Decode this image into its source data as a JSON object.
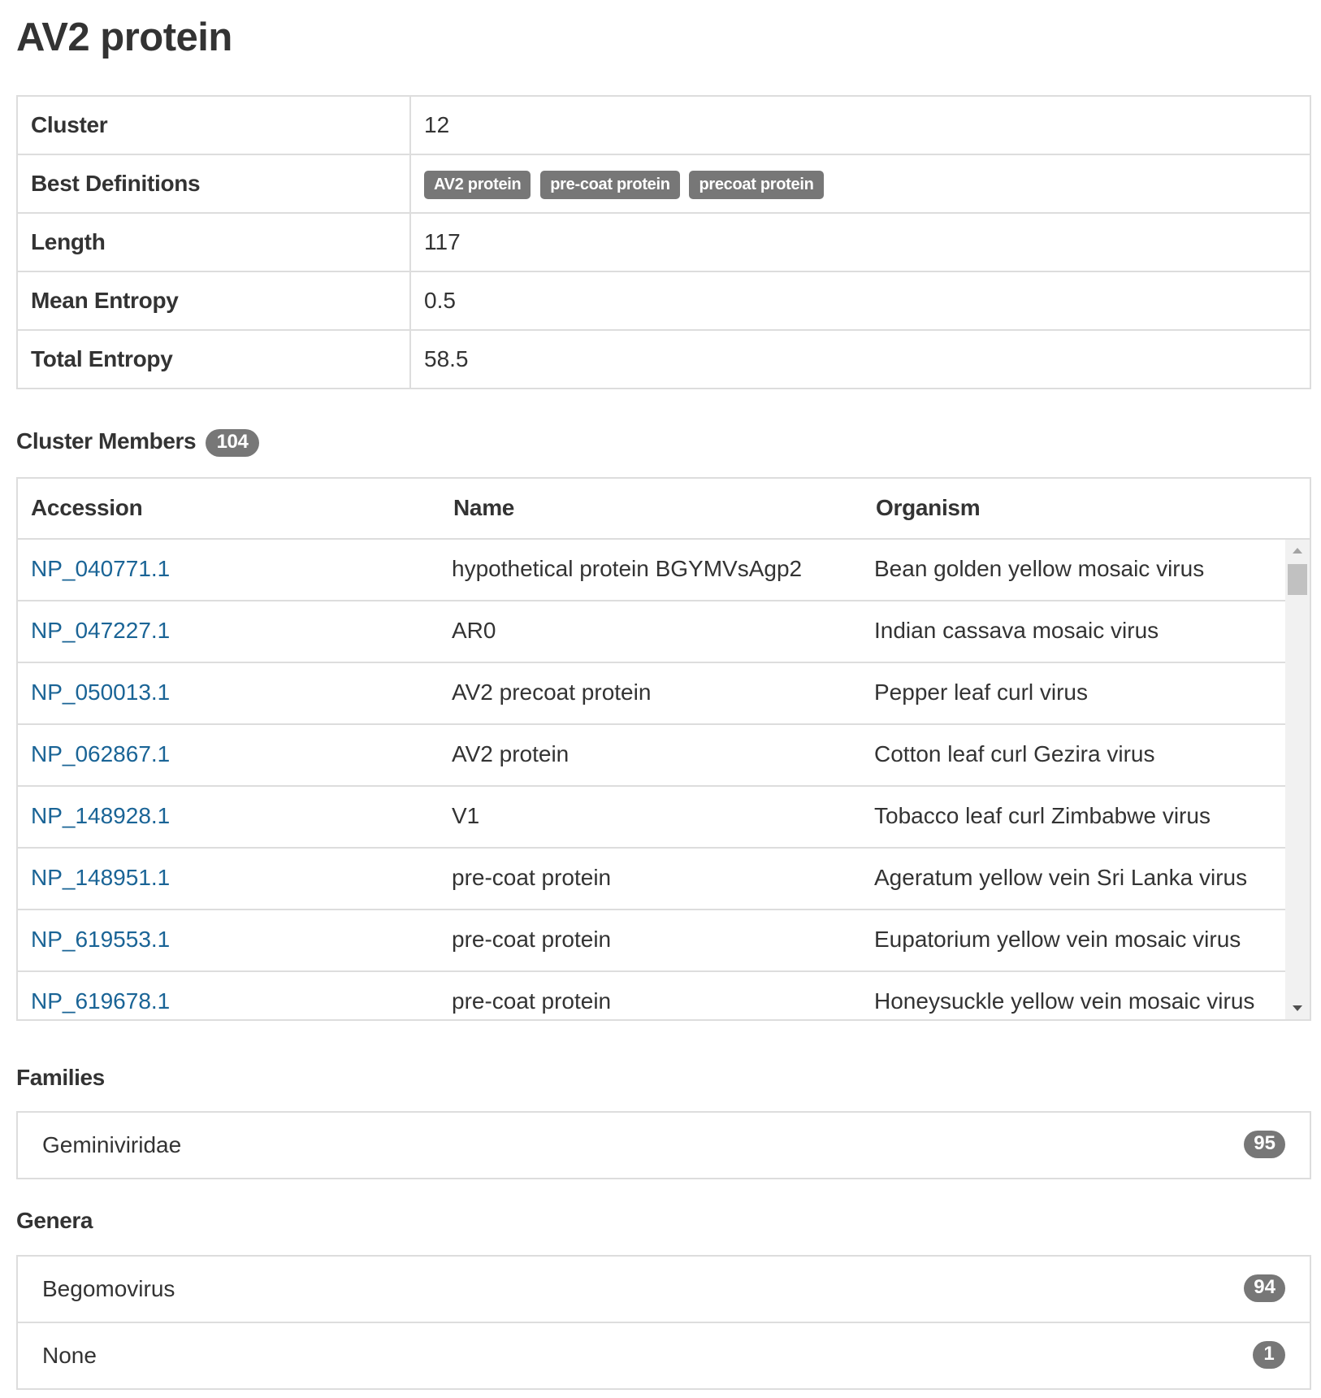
{
  "page_title": "AV2 protein",
  "info": {
    "cluster_label": "Cluster",
    "cluster_value": "12",
    "definitions_label": "Best Definitions",
    "definitions": [
      "AV2 protein",
      "pre-coat protein",
      "precoat protein"
    ],
    "length_label": "Length",
    "length_value": "117",
    "mean_entropy_label": "Mean Entropy",
    "mean_entropy_value": "0.5",
    "total_entropy_label": "Total Entropy",
    "total_entropy_value": "58.5"
  },
  "members": {
    "heading": "Cluster Members",
    "count": "104",
    "columns": [
      "Accession",
      "Name",
      "Organism"
    ],
    "rows": [
      {
        "accession": "NP_040771.1",
        "name": "hypothetical protein BGYMVsAgp2",
        "organism": "Bean golden yellow mosaic virus"
      },
      {
        "accession": "NP_047227.1",
        "name": "AR0",
        "organism": "Indian cassava mosaic virus"
      },
      {
        "accession": "NP_050013.1",
        "name": "AV2 precoat protein",
        "organism": "Pepper leaf curl virus"
      },
      {
        "accession": "NP_062867.1",
        "name": "AV2 protein",
        "organism": "Cotton leaf curl Gezira virus"
      },
      {
        "accession": "NP_148928.1",
        "name": "V1",
        "organism": "Tobacco leaf curl Zimbabwe virus"
      },
      {
        "accession": "NP_148951.1",
        "name": "pre-coat protein",
        "organism": "Ageratum yellow vein Sri Lanka virus"
      },
      {
        "accession": "NP_619553.1",
        "name": "pre-coat protein",
        "organism": "Eupatorium yellow vein mosaic virus"
      },
      {
        "accession": "NP_619678.1",
        "name": "pre-coat protein",
        "organism": "Honeysuckle yellow vein mosaic virus"
      }
    ]
  },
  "families": {
    "heading": "Families",
    "items": [
      {
        "label": "Geminiviridae",
        "count": "95"
      }
    ]
  },
  "genera": {
    "heading": "Genera",
    "items": [
      {
        "label": "Begomovirus",
        "count": "94"
      },
      {
        "label": "None",
        "count": "1"
      }
    ]
  },
  "colors": {
    "link": "#1a6496",
    "badge": "#777777",
    "border": "#dddddd",
    "text": "#333333"
  }
}
